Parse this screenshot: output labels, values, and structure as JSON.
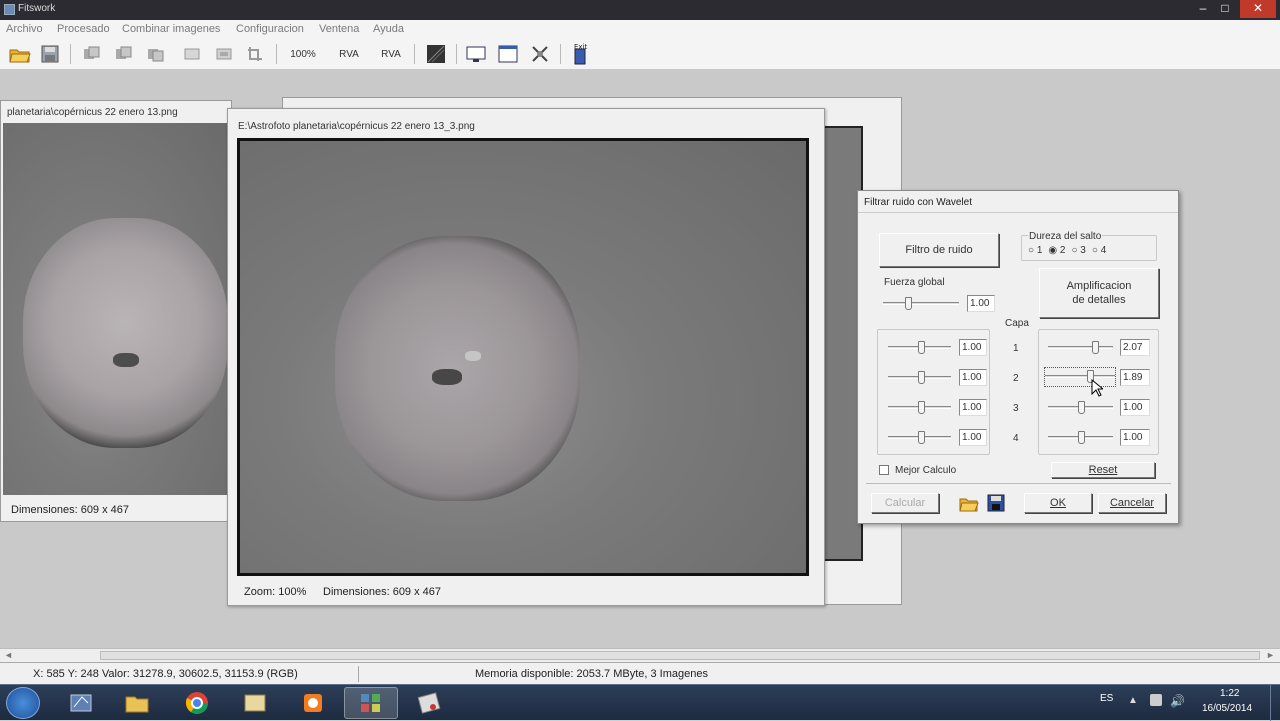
{
  "app": {
    "title": "Fitswork"
  },
  "menu": {
    "items": [
      "Archivo",
      "Procesado",
      "Combinar imagenes",
      "Configuracion",
      "Ventena",
      "Ayuda"
    ]
  },
  "toolbar": {
    "zoom_label": "100%",
    "rva1": "RVA",
    "rva2": "RVA",
    "exit_label": "Exit"
  },
  "back_window": {
    "title": "planetaria\\copérnicus 22 enero 13.png",
    "status": "Dimensiones: 609 x 467"
  },
  "front_window": {
    "title": "E:\\Astrofoto planetaria\\copérnicus 22 enero 13_3.png",
    "zoom": "Zoom: 100%",
    "dimensions": "Dimensiones: 609 x 467"
  },
  "dialog": {
    "title": "Filtrar ruido con Wavelet",
    "noise_filter_label": "Filtro de ruido",
    "hardness_label": "Dureza del salto",
    "hardness_options": [
      "1",
      "2",
      "3",
      "4"
    ],
    "hardness_selected": "2",
    "global_force_label": "Fuerza global",
    "global_force_value": "1.00",
    "detail_amp_label": "Amplificacion\nde detalles",
    "layer_label": "Capa",
    "layers": [
      {
        "num": "1",
        "noise": "1.00",
        "detail": "2.07"
      },
      {
        "num": "2",
        "noise": "1.00",
        "detail": "1.89"
      },
      {
        "num": "3",
        "noise": "1.00",
        "detail": "1.00"
      },
      {
        "num": "4",
        "noise": "1.00",
        "detail": "1.00"
      }
    ],
    "better_calc_label": "Mejor Calculo",
    "better_calc_checked": false,
    "reset_label": "Reset",
    "calc_label": "Calcular",
    "ok_label": "OK",
    "cancel_label": "Cancelar"
  },
  "statusbar": {
    "coords": "X: 585  Y: 248  Valor: 31278.9, 30602.5, 31153.9 (RGB)",
    "memory": "Memoria disponible: 2053.7 MByte, 3 Imagenes"
  },
  "taskbar": {
    "lang": "ES",
    "time": "1:22",
    "date": "16/05/2014"
  }
}
